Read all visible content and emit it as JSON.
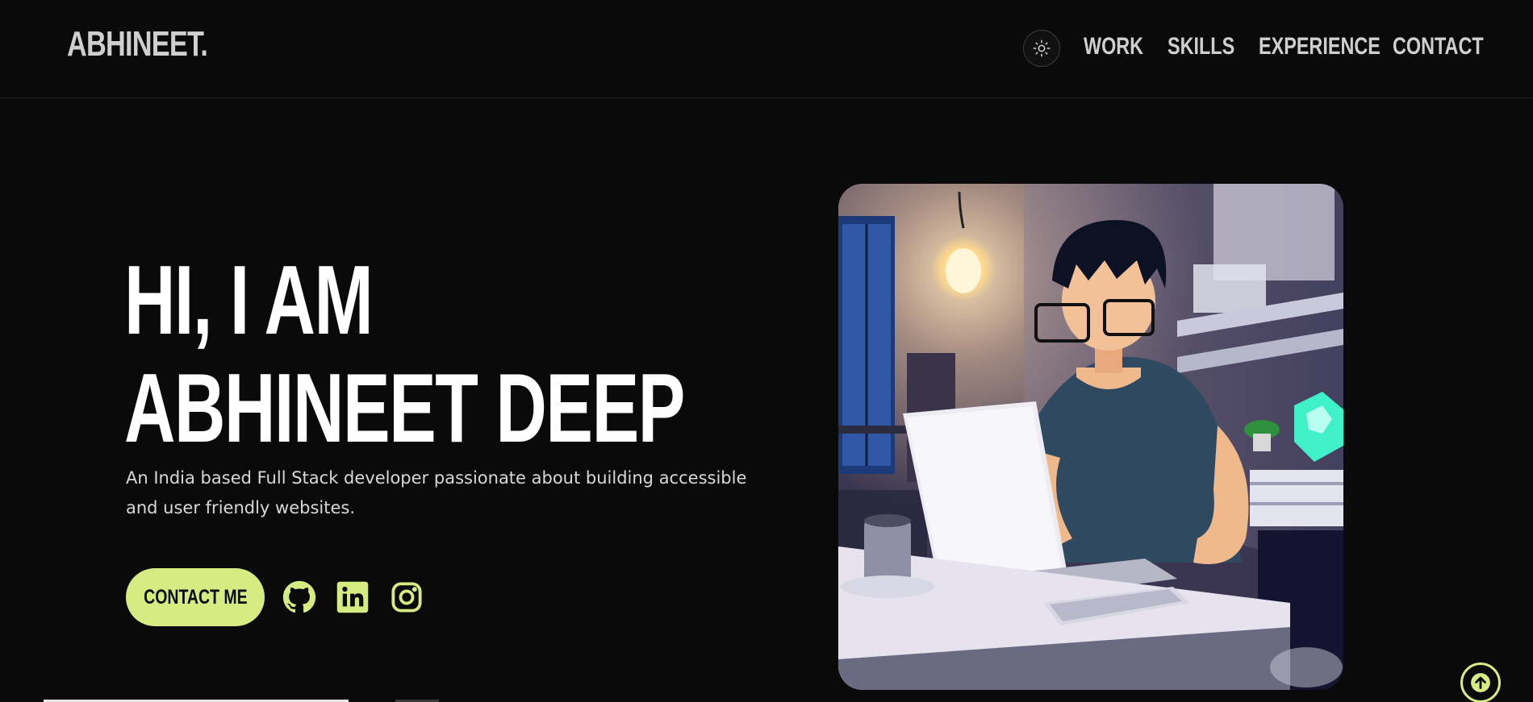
{
  "header": {
    "logo": "ABHINEET.",
    "nav": [
      {
        "label": "WORK"
      },
      {
        "label": "SKILLS"
      },
      {
        "label": "EXPERIENCE"
      },
      {
        "label": "CONTACT"
      }
    ]
  },
  "hero": {
    "title_line1": "HI, I AM",
    "title_line2": "ABHINEET DEEP",
    "description": "An India based Full Stack developer passionate about building accessible and user friendly websites.",
    "contact_label": "CONTACT ME",
    "socials": [
      "github-icon",
      "linkedin-icon",
      "instagram-icon"
    ]
  },
  "colors": {
    "background": "#0a0a0a",
    "accent": "#d6ec82",
    "text": "#ffffff",
    "nav_text": "#cfcfcf"
  }
}
